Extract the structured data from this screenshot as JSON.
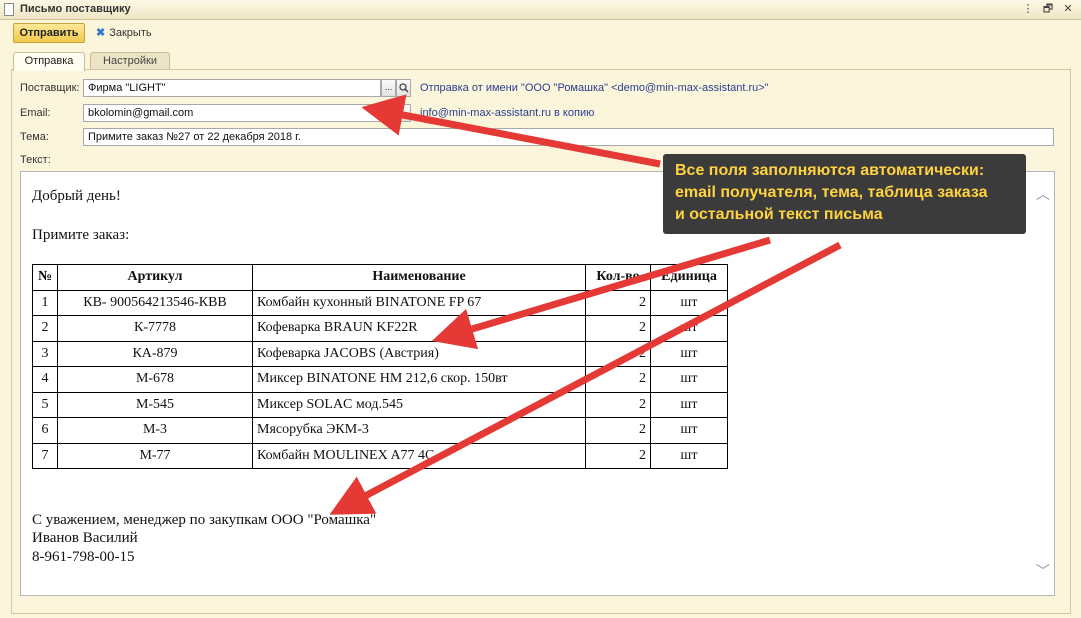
{
  "window": {
    "title": "Письмо поставщику",
    "controls": [
      "⋮",
      "🗗",
      "✕"
    ]
  },
  "toolbar": {
    "send_label": "Отправить",
    "close_label": "Закрыть"
  },
  "tabs": [
    {
      "label": "Отправка",
      "active": true
    },
    {
      "label": "Настройки",
      "active": false
    }
  ],
  "form": {
    "supplier_label": "Поставщик:",
    "supplier_value": "Фирма \"LIGHT\"",
    "select_button": "...",
    "sender_note": "Отправка от имени \"ООО \"Ромашка\" <demo@min-max-assistant.ru>\"",
    "email_label": "Email:",
    "email_value": "bkolomin@gmail.com",
    "cc_note": "info@min-max-assistant.ru в копию",
    "subject_label": "Тема:",
    "subject_value": "Примите заказ №27 от 22 декабря 2018 г.",
    "text_label": "Текст:"
  },
  "letter": {
    "greeting": "Добрый день!",
    "intro": "Примите заказ:",
    "table": {
      "headers": [
        "№",
        "Артикул",
        "Наименование",
        "Кол-во",
        "Единица"
      ],
      "rows": [
        [
          "1",
          "КВ- 900564213546-КВВ",
          "Комбайн кухонный BINATONE FP 67",
          "2",
          "шт"
        ],
        [
          "2",
          "К-7778",
          "Кофеварка BRAUN KF22R",
          "2",
          "шт"
        ],
        [
          "3",
          "КА-879",
          "Кофеварка JACOBS (Австрия)",
          "2",
          "шт"
        ],
        [
          "4",
          "М-678",
          "Миксер BINATONE HM 212,6 скор. 150вт",
          "2",
          "шт"
        ],
        [
          "5",
          "М-545",
          "Миксер SOLAC мод.545",
          "2",
          "шт"
        ],
        [
          "6",
          "М-3",
          "Мясорубка ЭКМ-3",
          "2",
          "шт"
        ],
        [
          "7",
          "М-77",
          "Комбайн MOULINEX A77 4C",
          "2",
          "шт"
        ]
      ]
    },
    "signature": [
      "С уважением, менеджер по закупкам ООО \"Ромашка\"",
      "Иванов Василий",
      "8-961-798-00-15"
    ]
  },
  "callout": {
    "lines": [
      "Все поля заполняются автоматически:",
      "email получателя, тема, таблица заказа",
      "и остальной текст письма"
    ]
  },
  "colors": {
    "accent_button": "#f0c94a",
    "callout_bg": "#3b3b3b",
    "callout_text": "#ffd23f",
    "arrow": "#e53935",
    "window_bg": "#fbf5dc"
  },
  "icons": {
    "doc": "document-icon",
    "close": "close-x-icon",
    "search": "search-icon"
  }
}
